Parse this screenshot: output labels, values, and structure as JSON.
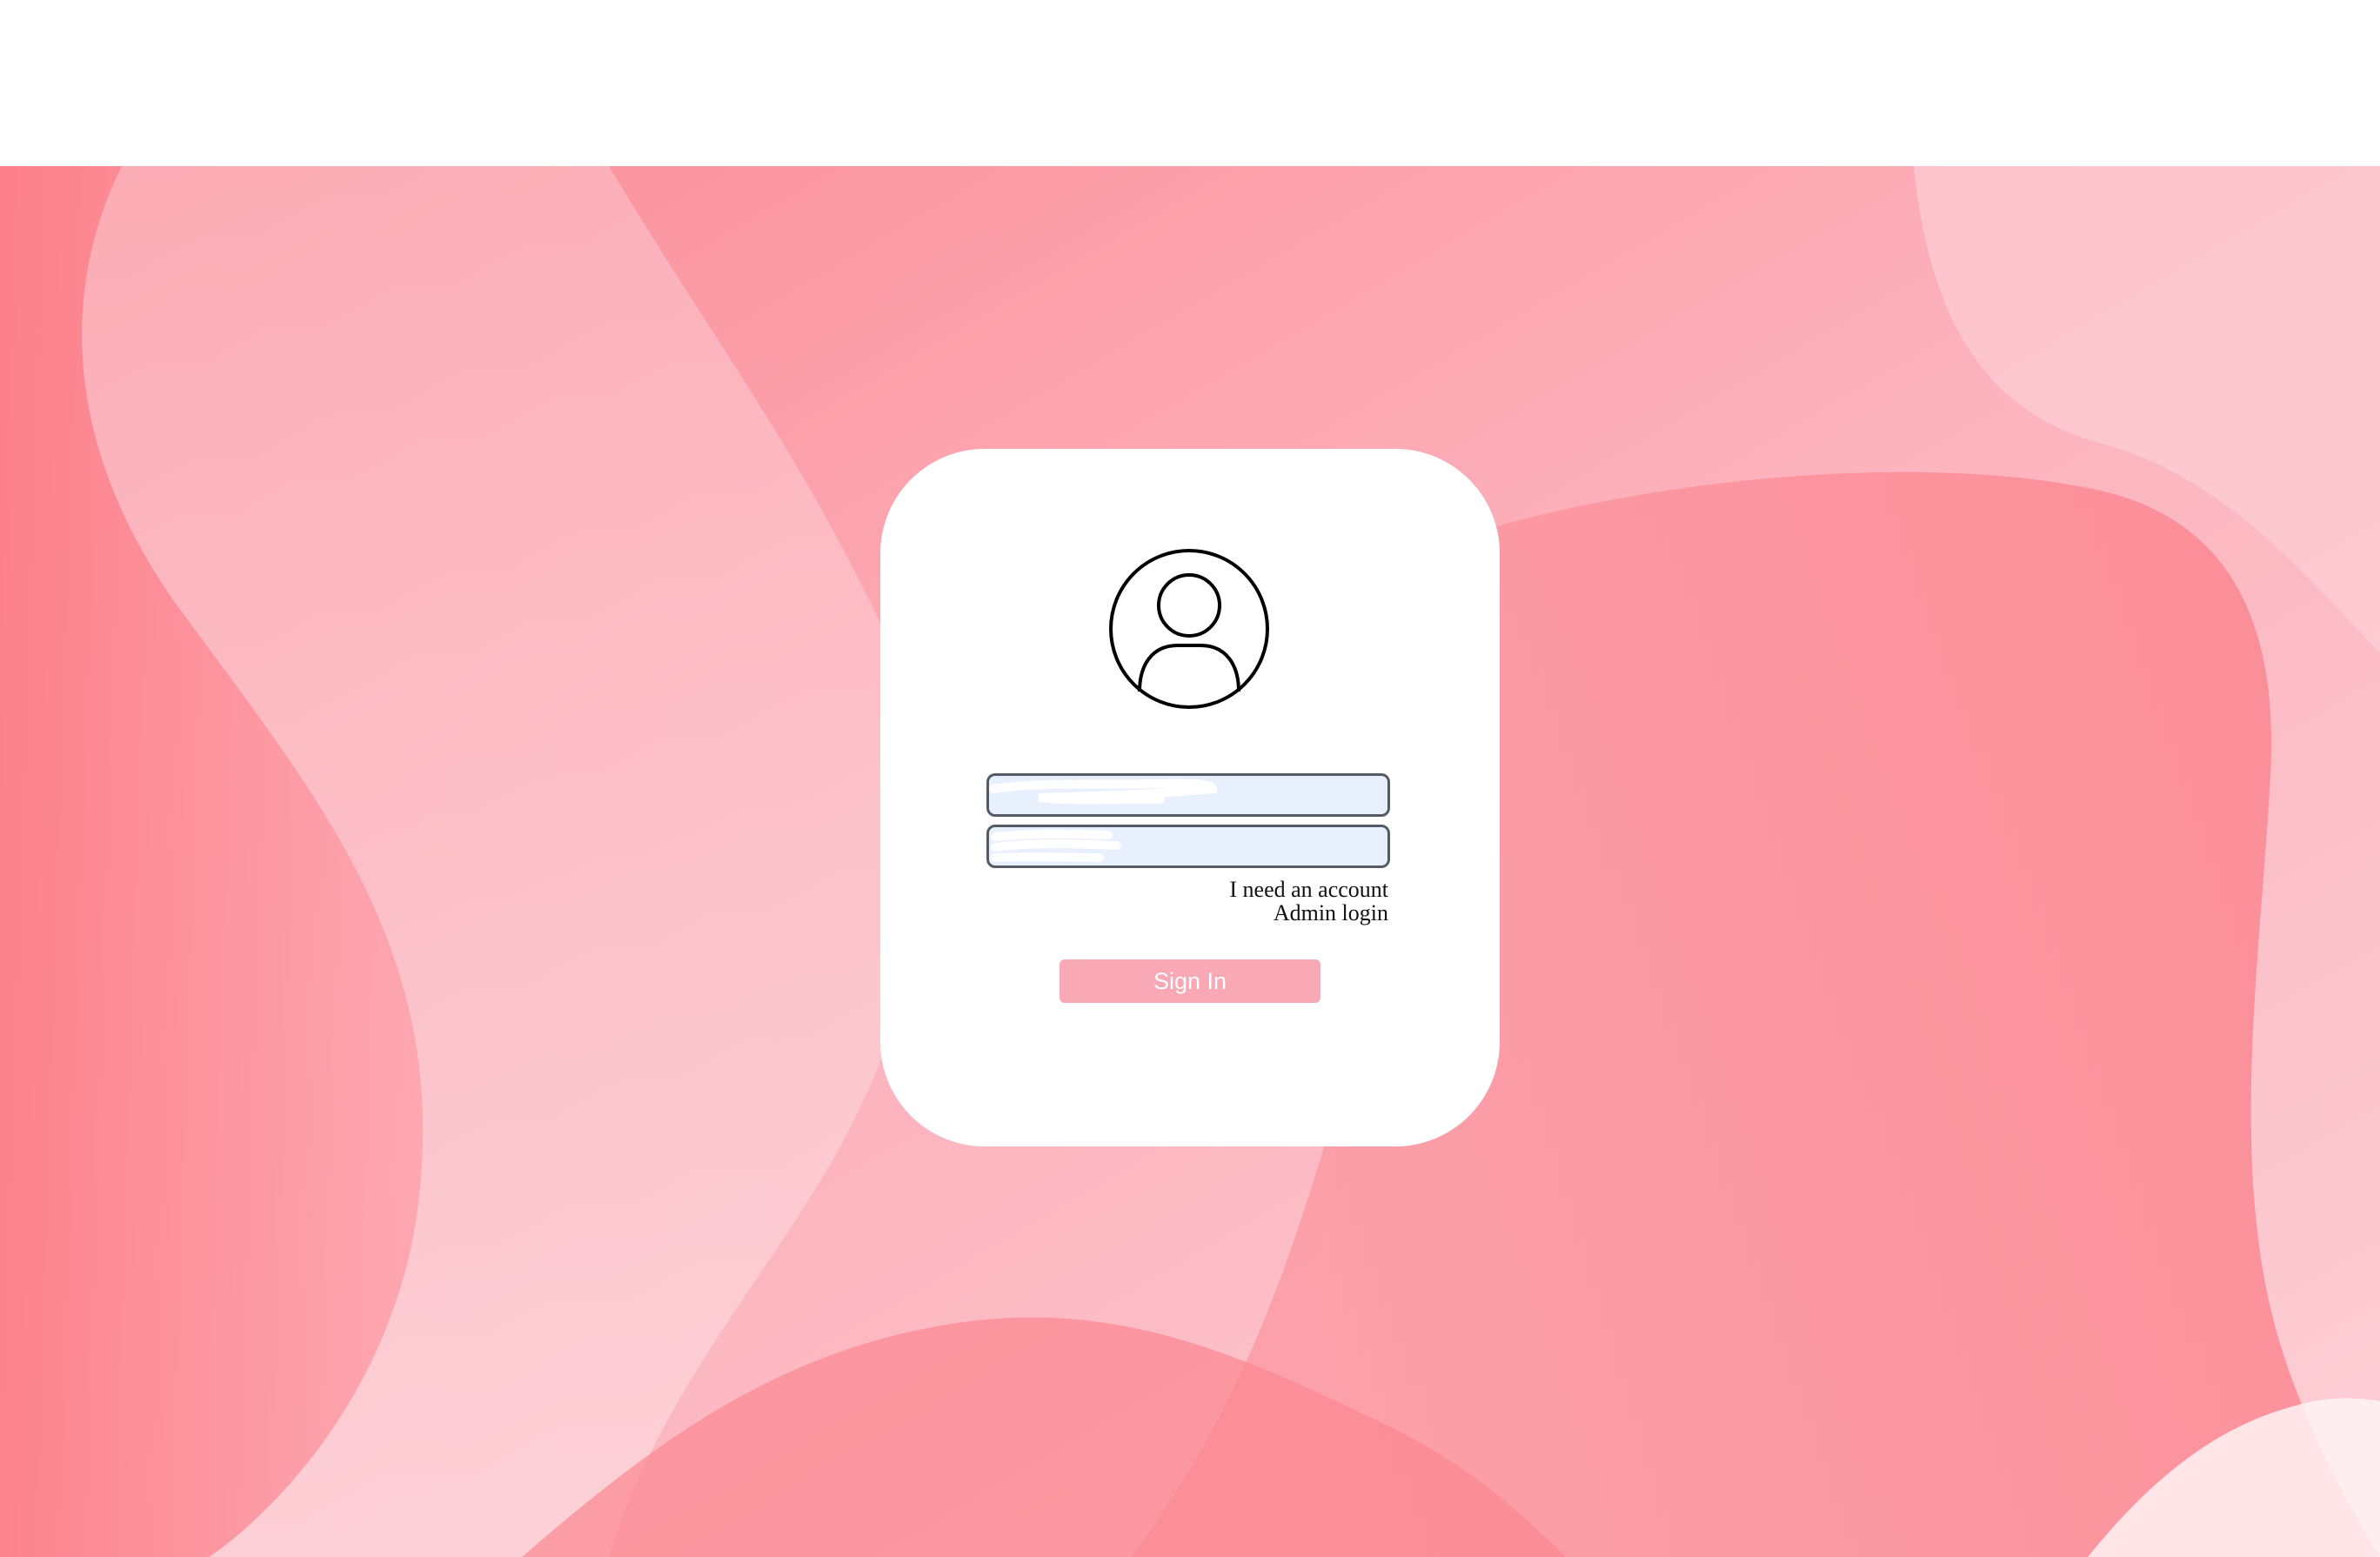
{
  "colors": {
    "background_pink": "#f9a3ae",
    "card": "#ffffff",
    "input_fill": "#e8f0fe",
    "input_border": "#555b66",
    "button": "#f9a8b5",
    "button_text": "#ffffff"
  },
  "login_card": {
    "avatar_icon": "user-circle-icon",
    "username": {
      "value": "",
      "placeholder": ""
    },
    "password": {
      "value": "",
      "placeholder": ""
    },
    "links": {
      "need_account": "I need an account",
      "admin_login": "Admin login"
    },
    "sign_in_label": "Sign In"
  }
}
